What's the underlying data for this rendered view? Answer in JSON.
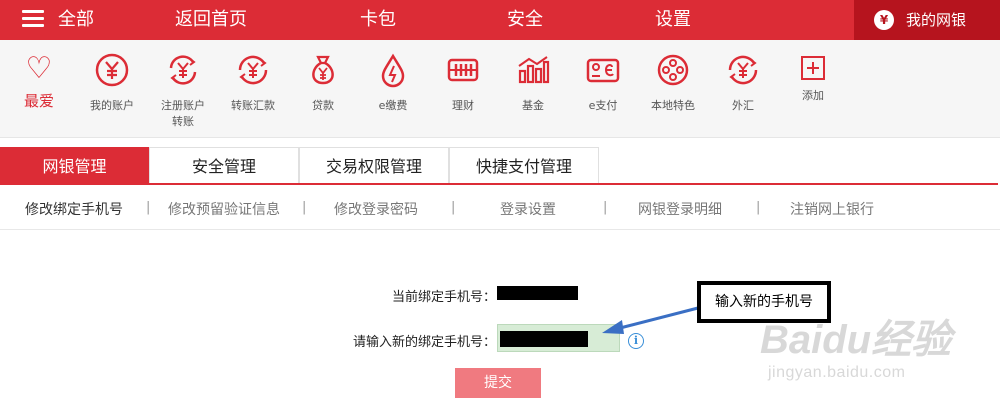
{
  "topbar": {
    "menu_label": "全部",
    "nav": [
      "返回首页",
      "卡包",
      "安全",
      "设置"
    ],
    "mybank_label": "我的网银",
    "mybank_icon": "money-bag-icon"
  },
  "favorites": {
    "label": "最爱",
    "icon": "heart-icon"
  },
  "shortcuts": [
    {
      "label": "我的账户",
      "icon": "yuan-coin-icon"
    },
    {
      "label": "注册账户",
      "label2": "转账",
      "icon": "yuan-transfer-icon"
    },
    {
      "label": "转账汇款",
      "icon": "yuan-exchange-icon"
    },
    {
      "label": "贷款",
      "icon": "money-bag-icon"
    },
    {
      "label": "e缴费",
      "icon": "water-drop-icon"
    },
    {
      "label": "理财",
      "icon": "abacus-icon"
    },
    {
      "label": "基金",
      "icon": "bar-chart-icon"
    },
    {
      "label": "e支付",
      "icon": "card-pay-icon"
    },
    {
      "label": "本地特色",
      "icon": "film-reel-icon"
    },
    {
      "label": "外汇",
      "icon": "yuan-exchange-icon"
    },
    {
      "label": "添加",
      "icon": "plus-icon"
    }
  ],
  "tabs": [
    "网银管理",
    "安全管理",
    "交易权限管理",
    "快捷支付管理"
  ],
  "subnav": [
    "修改绑定手机号",
    "修改预留验证信息",
    "修改登录密码",
    "登录设置",
    "网银登录明细",
    "注销网上银行"
  ],
  "subnav_separator": "|",
  "form": {
    "current_label": "当前绑定手机号：",
    "new_label": "请输入新的绑定手机号：",
    "info_glyph": "i",
    "submit_label": "提交"
  },
  "annotation": {
    "callout_text": "输入新的手机号"
  },
  "watermark": {
    "brand": "Baidu经验",
    "url": "jingyan.baidu.com"
  },
  "colors": {
    "primary": "#dc2c36",
    "primary_dark": "#b6141e",
    "submit": "#f07a80",
    "input_bg": "#d7ecd6",
    "info": "#3a8fd8"
  }
}
